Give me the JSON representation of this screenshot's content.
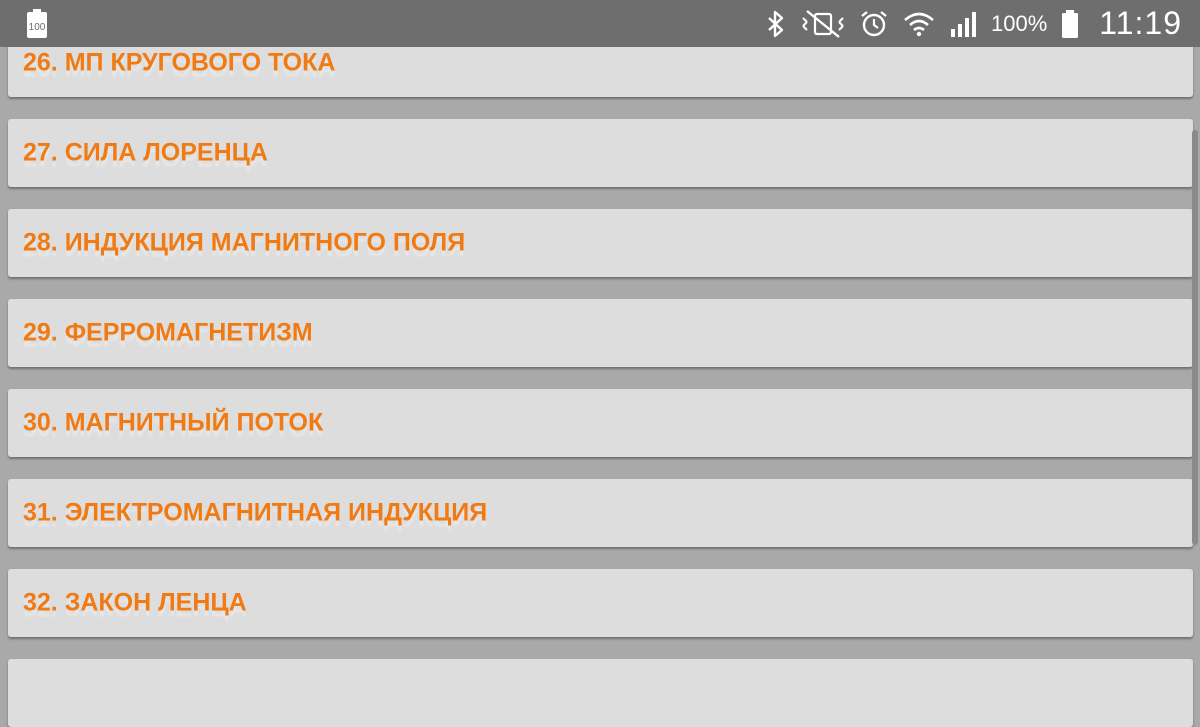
{
  "status_bar": {
    "notification_badge": "100",
    "battery_percent": "100%",
    "time": "11:19",
    "icons": [
      "bluetooth-icon",
      "vibrate-mute-icon",
      "alarm-icon",
      "wifi-icon",
      "signal-icon",
      "battery-icon"
    ]
  },
  "list": {
    "items": [
      {
        "label": "26. МП КРУГОВОГО ТОКА"
      },
      {
        "label": "27. СИЛА ЛОРЕНЦА"
      },
      {
        "label": "28. ИНДУКЦИЯ МАГНИТНОГО ПОЛЯ"
      },
      {
        "label": "29. ФЕРРОМАГНЕТИЗМ"
      },
      {
        "label": "30. МАГНИТНЫЙ ПОТОК"
      },
      {
        "label": "31. ЭЛЕКТРОМАГНИТНАЯ ИНДУКЦИЯ"
      },
      {
        "label": "32. ЗАКОН ЛЕНЦА"
      },
      {
        "label": ""
      }
    ]
  },
  "colors": {
    "accent_text": "#f07a14",
    "item_background": "#dddddd",
    "page_background": "#a9a9a9",
    "status_bar": "#6e6e6e"
  }
}
